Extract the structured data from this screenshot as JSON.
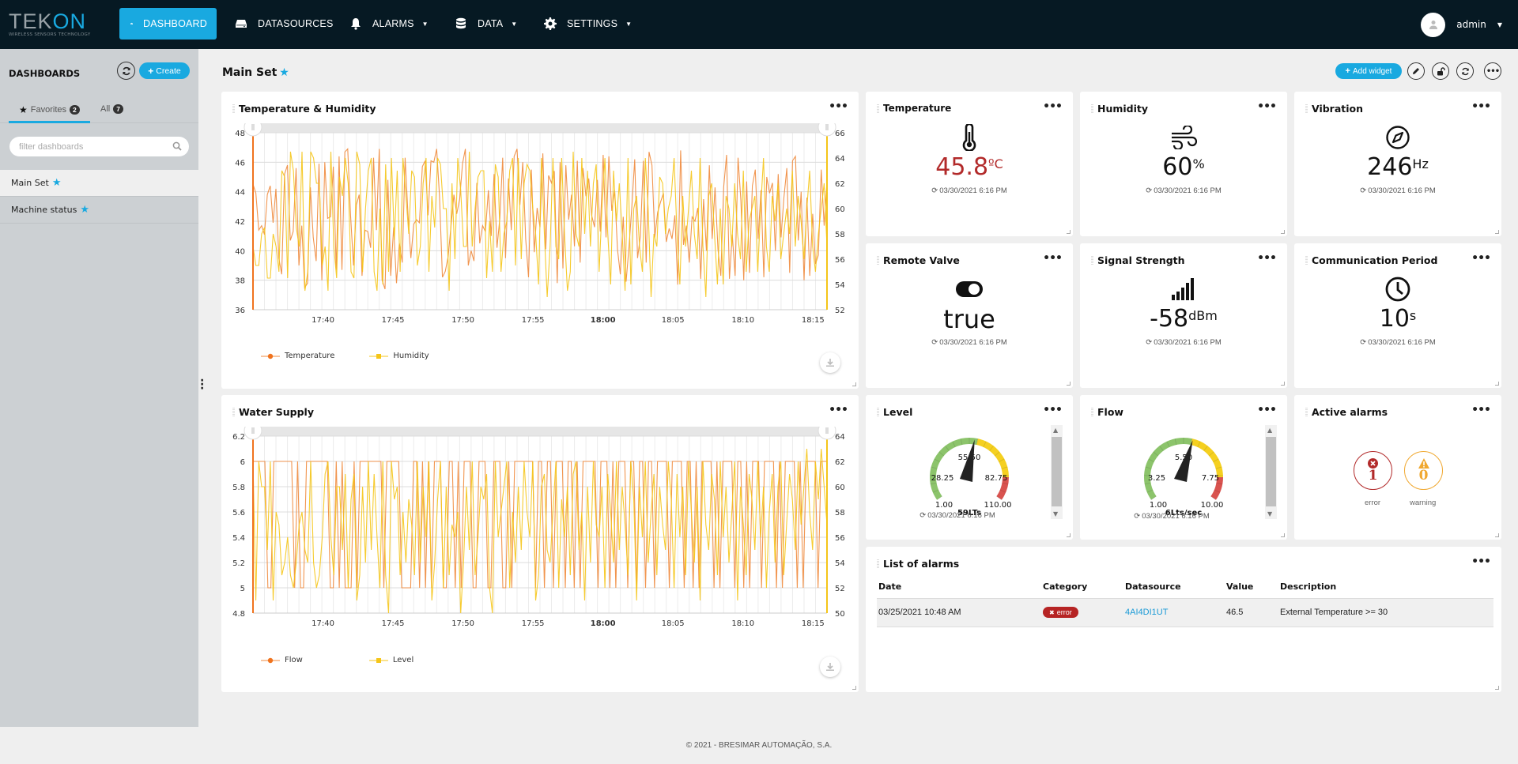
{
  "app": {
    "logo_text_a": "TEK",
    "logo_text_b": "ON",
    "logo_tagline": "WIRELESS SENSORS TECHNOLOGY"
  },
  "nav": {
    "items": [
      {
        "label": "DASHBOARD",
        "icon": "dashboard-gauge-icon",
        "active": true
      },
      {
        "label": "DATASOURCES",
        "icon": "hard-drive-icon"
      },
      {
        "label": "ALARMS",
        "icon": "bell-icon",
        "dropdown": true
      },
      {
        "label": "DATA",
        "icon": "database-icon",
        "dropdown": true
      },
      {
        "label": "SETTINGS",
        "icon": "gear-icon",
        "dropdown": true
      }
    ],
    "user": "admin"
  },
  "sidebar": {
    "title": "DASHBOARDS",
    "create_label": "Create",
    "tabs": [
      {
        "label": "Favorites",
        "count": "2",
        "active": true
      },
      {
        "label": "All",
        "count": "7"
      }
    ],
    "filter_placeholder": "filter dashboards",
    "items": [
      {
        "label": "Main Set",
        "favorite": true,
        "active": true
      },
      {
        "label": "Machine status",
        "favorite": true
      }
    ]
  },
  "page": {
    "title": "Main Set",
    "add_widget_label": "Add widget"
  },
  "widgets": {
    "temp_humidity": {
      "title": "Temperature & Humidity"
    },
    "water_supply": {
      "title": "Water Supply"
    },
    "temperature": {
      "title": "Temperature",
      "value": "45.8",
      "unit": "ºC",
      "timestamp": "03/30/2021 6:16 PM",
      "value_color": "#b22a2a"
    },
    "humidity": {
      "title": "Humidity",
      "value": "60",
      "unit": "%",
      "timestamp": "03/30/2021 6:16 PM"
    },
    "vibration": {
      "title": "Vibration",
      "value": "246",
      "unit": "Hz",
      "timestamp": "03/30/2021 6:16 PM"
    },
    "remote_valve": {
      "title": "Remote Valve",
      "value": "true",
      "unit": "",
      "timestamp": "03/30/2021 6:16 PM"
    },
    "signal": {
      "title": "Signal Strength",
      "value": "-58",
      "unit": "dBm",
      "timestamp": "03/30/2021 6:16 PM"
    },
    "comm_period": {
      "title": "Communication Period",
      "value": "10",
      "unit": "s",
      "timestamp": "03/30/2021 6:16 PM"
    },
    "level": {
      "title": "Level",
      "min": 1,
      "max": 110,
      "value": 59,
      "ticks": [
        "1.00",
        "28.25",
        "55.50",
        "82.75",
        "110.00"
      ],
      "readout": "59LTs",
      "timestamp": "03/30/2021 6:16 PM"
    },
    "flow": {
      "title": "Flow",
      "min": 1,
      "max": 10,
      "value": 6,
      "ticks": [
        "1.00",
        "3.25",
        "5.50",
        "7.75",
        "10.00"
      ],
      "readout": "6Lts/sec",
      "timestamp": "03/30/2021 6:16 PM"
    },
    "active_alarms": {
      "title": "Active alarms",
      "error_count": "1",
      "error_label": "error",
      "warning_count": "0",
      "warning_label": "warning"
    },
    "alarm_list": {
      "title": "List of alarms",
      "columns": [
        "Date",
        "Category",
        "Datasource",
        "Value",
        "Description"
      ],
      "rows": [
        {
          "date": "03/25/2021 10:48 AM",
          "category": "error",
          "datasource": "4AI4DI1UT",
          "value": "46.5",
          "description": "External Temperature >= 30"
        }
      ]
    }
  },
  "chart_data": [
    {
      "type": "line",
      "title": "Temperature & Humidity",
      "x_ticks": [
        "17:40",
        "17:45",
        "17:50",
        "17:55",
        "18:00",
        "18:05",
        "18:10",
        "18:15"
      ],
      "x_range": [
        "17:35",
        "18:16"
      ],
      "y_left": {
        "range": [
          36,
          48
        ],
        "ticks": [
          36,
          38,
          40,
          42,
          44,
          46,
          48
        ]
      },
      "y_right": {
        "range": [
          52,
          66
        ],
        "ticks": [
          52,
          54,
          56,
          58,
          60,
          62,
          64,
          66
        ]
      },
      "grid": true,
      "legend": "bottom-left",
      "series": [
        {
          "name": "Temperature",
          "axis": "left",
          "color": "#f08a3c",
          "marker": "circle",
          "values": [
            44.5,
            43.9,
            41.4,
            41.7,
            41.1,
            43.8,
            44.4,
            41.9,
            44.2,
            39.5,
            38.4,
            45.2,
            45.8,
            40.7,
            41.3,
            45.6,
            39.0,
            41.7,
            37.5,
            37.8,
            44.3,
            40.9,
            39.3,
            45.9,
            38.0,
            46.0,
            42.2,
            42.3,
            45.7,
            38.7,
            46.4,
            38.7,
            46.7,
            46.9,
            42.4,
            39.0,
            43.1,
            43.8,
            38.3,
            41.4,
            41.3,
            40.2,
            46.3,
            41.4,
            46.9,
            38.0,
            37.4,
            44.8,
            38.3,
            41.6,
            37.8,
            40.5,
            39.2,
            46.3,
            42.5,
            39.5,
            41.8,
            42.1,
            41.9,
            45.7,
            46.1,
            42.4,
            46.1,
            46.0,
            46.9,
            43.7,
            38.2,
            38.6,
            39.6,
            41.7,
            43.8,
            42.5,
            43.5,
            45.9,
            46.9,
            39.0,
            40.0,
            39.3,
            44.6,
            40.5,
            41.7,
            41.3,
            44.1,
            41.0,
            45.2,
            40.2,
            42.2,
            46.3,
            39.5,
            44.9,
            41.4,
            46.4,
            46.9,
            43.1,
            46.0,
            40.8,
            38.2,
            45.5,
            39.9,
            42.9,
            41.6,
            46.6,
            40.1,
            45.1,
            44.6,
            45.4,
            37.8,
            46.0,
            38.8,
            45.8,
            42.1,
            43.8,
            40.3,
            46.1,
            39.2,
            45.6,
            43.7,
            44.9,
            42.4,
            41.6,
            44.8,
            41.3,
            46.5,
            40.9,
            46.4,
            42.7,
            44.1,
            40.1,
            38.4,
            42.3,
            37.9,
            40.2,
            43.0,
            46.2,
            39.5,
            41.0,
            46.1,
            39.2,
            46.7,
            45.8,
            40.9,
            42.6,
            43.3,
            43.9,
            40.6,
            41.5,
            40.8,
            42.4,
            37.7,
            46.8,
            40.4,
            41.7,
            39.2,
            42.3,
            42.0,
            42.9,
            38.1,
            43.5,
            40.0,
            45.8,
            40.8,
            44.3,
            40.1,
            38.3,
            44.3,
            46.5,
            38.1,
            41.1,
            38.3,
            46.3,
            43.4,
            38.0,
            44.7,
            38.5,
            44.4,
            45.5,
            40.8,
            44.1,
            38.2,
            45.0,
            43.9,
            44.6,
            40.0,
            45.2,
            40.9,
            43.6,
            45.6,
            38.5,
            46.1,
            46.4,
            40.7,
            44.0,
            38.0,
            43.6,
            38.3,
            42.5,
            39.1,
            39.7,
            45.5,
            41.7,
            44.7
          ]
        },
        {
          "name": "Humidity",
          "axis": "right",
          "color": "#f5c518",
          "marker": "square",
          "values": [
            57,
            55.5,
            55.5,
            58,
            58.5,
            54.5,
            54.5,
            58,
            57,
            55,
            63,
            62.5,
            54.5,
            64.5,
            63,
            58.5,
            57,
            64.5,
            53.5,
            55,
            64.5,
            64,
            62,
            62,
            55.5,
            57,
            53.5,
            64.5,
            57,
            54.5,
            62.5,
            61,
            64,
            62,
            55,
            54.5,
            64.5,
            63.5,
            55,
            60,
            63,
            64,
            55,
            53.5,
            60,
            54,
            63.5,
            55,
            64,
            57.5,
            63,
            55,
            64,
            61,
            58,
            63,
            62.5,
            55.5,
            57,
            62,
            64,
            55,
            61,
            58.5,
            64,
            63.5,
            60,
            60,
            53.5,
            62,
            56,
            64,
            61.5,
            57,
            57,
            64.5,
            57,
            60,
            62.5,
            63,
            63,
            54.5,
            59,
            55,
            63.5,
            62.5,
            55,
            58,
            59,
            63,
            64,
            55.5,
            64,
            56,
            62,
            63.5,
            63,
            60,
            58,
            54,
            64,
            58,
            53,
            57,
            64,
            57,
            56,
            64,
            58,
            53.5,
            55,
            64.5,
            58,
            57,
            64,
            58,
            63,
            57,
            62,
            63.5,
            55,
            60,
            64,
            58,
            54,
            63,
            59,
            62,
            58,
            53.5,
            64,
            54,
            60,
            61,
            57,
            55,
            64,
            60,
            53,
            58,
            57,
            62.5,
            62,
            58,
            60,
            61,
            64,
            58,
            54,
            61,
            57,
            60,
            63,
            58,
            56,
            64,
            57,
            53,
            61,
            62,
            58,
            54,
            60,
            54,
            61,
            60,
            57,
            62,
            58,
            56,
            63,
            55,
            59,
            60,
            61,
            55,
            60,
            64,
            57,
            55,
            61,
            59,
            62,
            56,
            58,
            60,
            58,
            63,
            57,
            61,
            59,
            56,
            60,
            63,
            57,
            55,
            58,
            60,
            62,
            57
          ]
        }
      ]
    },
    {
      "type": "line",
      "title": "Water Supply",
      "x_ticks": [
        "17:40",
        "17:45",
        "17:50",
        "17:55",
        "18:00",
        "18:05",
        "18:10",
        "18:15"
      ],
      "x_range": [
        "17:35",
        "18:16"
      ],
      "y_left": {
        "range": [
          4.8,
          6.2
        ],
        "ticks": [
          4.8,
          5.0,
          5.2,
          5.4,
          5.6,
          5.8,
          6.0,
          6.2
        ]
      },
      "y_right": {
        "range": [
          50,
          64
        ],
        "ticks": [
          50,
          52,
          54,
          56,
          58,
          60,
          62,
          64
        ]
      },
      "grid": true,
      "legend": "bottom-left",
      "series": [
        {
          "name": "Flow",
          "axis": "left",
          "color": "#f08a3c",
          "marker": "circle",
          "values": [
            6,
            6,
            6,
            6,
            6,
            5,
            5,
            6,
            6,
            6,
            6,
            6,
            6,
            6,
            5,
            6,
            5,
            5,
            6,
            6,
            6,
            6,
            6,
            6,
            6,
            6,
            5,
            5,
            6,
            5,
            6,
            5,
            5,
            5,
            6,
            5,
            6,
            6,
            6,
            6,
            6,
            6,
            6,
            6,
            5,
            6,
            6,
            6,
            6,
            6,
            5,
            5,
            5,
            5,
            6,
            6,
            5,
            6,
            5,
            6,
            5,
            6,
            6,
            6,
            5,
            5,
            6,
            6,
            5,
            6,
            5,
            6,
            6,
            6,
            5,
            5,
            6,
            6,
            6,
            5,
            5,
            6,
            6,
            6,
            5,
            5,
            6,
            5,
            6,
            6,
            6,
            6,
            6,
            6,
            6,
            5,
            6,
            6,
            5,
            6,
            6,
            5,
            6,
            6,
            6,
            5,
            6,
            6,
            5,
            6,
            5,
            6,
            6,
            6,
            6,
            6,
            5,
            6,
            6,
            6,
            5,
            6,
            5,
            6,
            6,
            6,
            5,
            6,
            6,
            5,
            6,
            6,
            5,
            6,
            6,
            5,
            6,
            6,
            6,
            6,
            5,
            6,
            6,
            6,
            6,
            5,
            6,
            6,
            5,
            6,
            5,
            6,
            6,
            6,
            6,
            5,
            6,
            5,
            6,
            6,
            6,
            6,
            5,
            6,
            6,
            5,
            6,
            5,
            6,
            6,
            6,
            5,
            6,
            6,
            6,
            6,
            5,
            6,
            5,
            6,
            6,
            6,
            6,
            5,
            6,
            5,
            6,
            6,
            6,
            6,
            5,
            6,
            6,
            6
          ]
        },
        {
          "name": "Level",
          "axis": "right",
          "color": "#f5c518",
          "marker": "square",
          "values": [
            62,
            51,
            62,
            60,
            60,
            55,
            62,
            51,
            58,
            57,
            53,
            54,
            56,
            53,
            52,
            54,
            57,
            58,
            55,
            54,
            62,
            54,
            52,
            53,
            56,
            61,
            62,
            56,
            53,
            60,
            60,
            55,
            61,
            52,
            59,
            61,
            51,
            53,
            60,
            54,
            62,
            55,
            61,
            56,
            52,
            62,
            53,
            50,
            62,
            59,
            60,
            53,
            58,
            54,
            59,
            57,
            53,
            62,
            54,
            60,
            56,
            62,
            51,
            54,
            59,
            62,
            52,
            60,
            53,
            57,
            56,
            58,
            50,
            54,
            60,
            55,
            62,
            53,
            56,
            60,
            59,
            61,
            52,
            50,
            62,
            56,
            58,
            60,
            62,
            52,
            58,
            54,
            60,
            55,
            62,
            58,
            56,
            62,
            51,
            53,
            60,
            61,
            55,
            54,
            58,
            62,
            52,
            59,
            56,
            60,
            53,
            61,
            62,
            55,
            58,
            51,
            60,
            54,
            62,
            57,
            56,
            60,
            52,
            61,
            58,
            54,
            62,
            55,
            60,
            57,
            53,
            62,
            59,
            51,
            60,
            56,
            62,
            54,
            58,
            61,
            53,
            60,
            57,
            55,
            62,
            59,
            52,
            61,
            56,
            60,
            53,
            62,
            58,
            54,
            60,
            51,
            62,
            57,
            55,
            61,
            59,
            53,
            62,
            56,
            60,
            54,
            58,
            62,
            51,
            60,
            57,
            53,
            61,
            59,
            55,
            62,
            56,
            60,
            52,
            58,
            61,
            54,
            60,
            62,
            53,
            57,
            61,
            59,
            55,
            62,
            57,
            60,
            63,
            58,
            55,
            62,
            59,
            63,
            60,
            57
          ]
        }
      ]
    }
  ],
  "footer": {
    "text": "© 2021 - BRESIMAR AUTOMAÇÃO, S.A."
  }
}
